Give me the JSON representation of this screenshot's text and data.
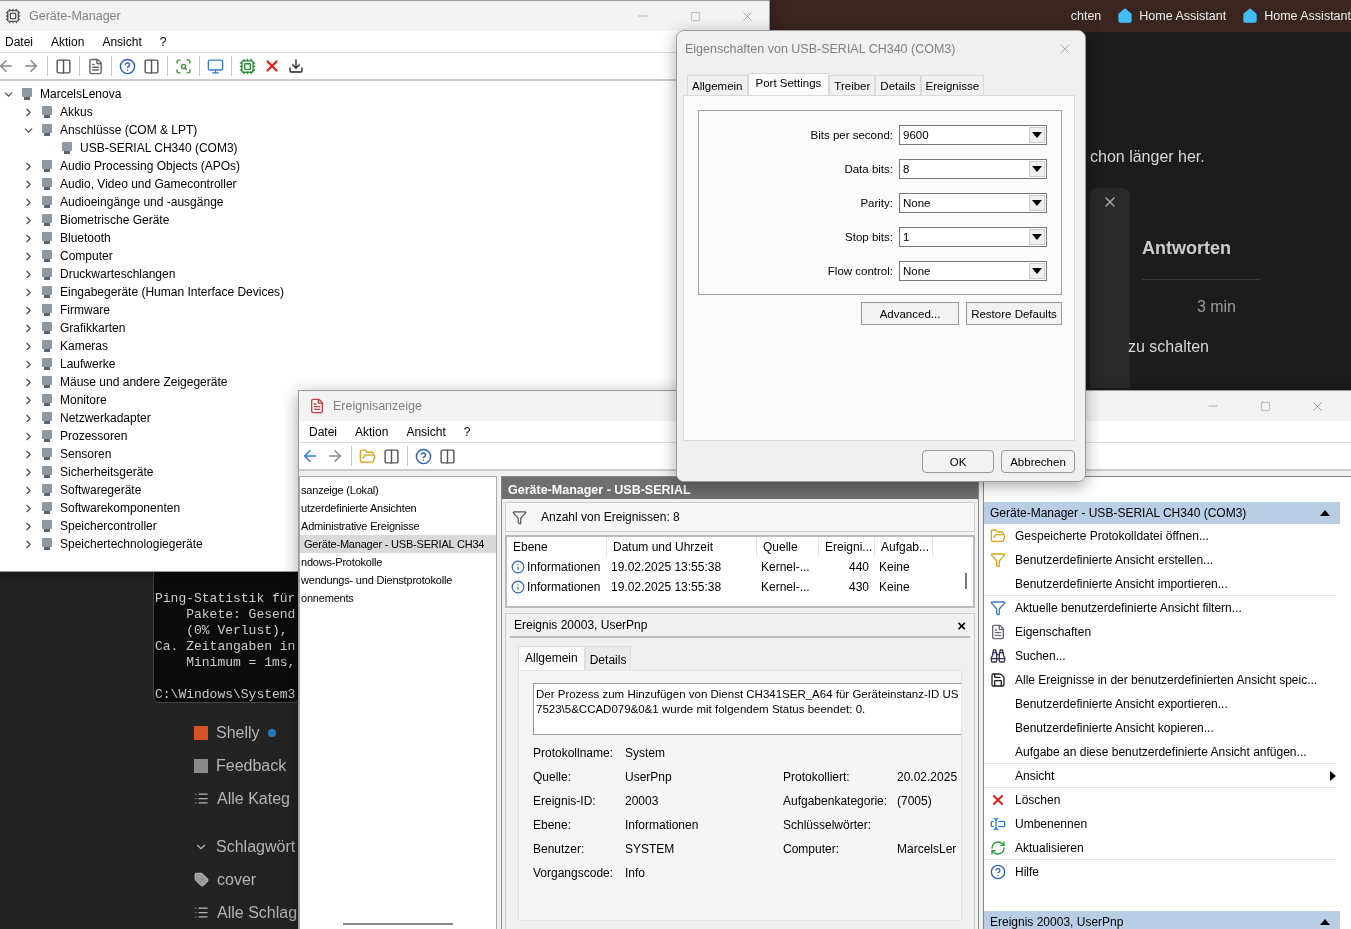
{
  "browser": {
    "tabs": [
      {
        "label": "chten",
        "icon": false
      },
      {
        "label": "Home Assistant",
        "icon": true
      },
      {
        "label": "Home Assistant",
        "icon": true
      }
    ],
    "heading": "chon länger her.",
    "reply_button": "Antworten",
    "time": "3 min",
    "text": "zu schalten",
    "sidebar": [
      {
        "kind": "category",
        "label": "Shelly",
        "color": "#d4512a",
        "unread": true
      },
      {
        "kind": "category",
        "label": "Feedback",
        "color": "#8a8a8a"
      },
      {
        "kind": "list",
        "label": "Alle Kateg"
      },
      {
        "kind": "section",
        "label": "Schlagwört",
        "expanded": true
      },
      {
        "kind": "tag",
        "label": "cover"
      },
      {
        "kind": "list",
        "label": "Alle Schlag"
      }
    ]
  },
  "terminal": {
    "lines": [
      "Ping-Statistik für",
      "    Pakete: Gesend",
      "    (0% Verlust),",
      "Ca. Zeitangaben in",
      "    Minimum = 1ms,"
    ],
    "prompt": "C:\\Windows\\System3"
  },
  "device_manager": {
    "title": "Geräte-Manager",
    "menu": [
      "Datei",
      "Aktion",
      "Ansicht",
      "?"
    ],
    "tree": [
      {
        "label": "MarcelsLenova",
        "expanded": true,
        "children": [
          {
            "label": "Akkus",
            "expanded": false
          },
          {
            "label": "Anschlüsse (COM & LPT)",
            "expanded": true,
            "children": [
              {
                "label": "USB-SERIAL CH340 (COM3)"
              }
            ]
          },
          {
            "label": "Audio Processing Objects (APOs)",
            "expanded": false
          },
          {
            "label": "Audio, Video und Gamecontroller",
            "expanded": false
          },
          {
            "label": "Audioeingänge und -ausgänge",
            "expanded": false
          },
          {
            "label": "Biometrische Geräte",
            "expanded": false
          },
          {
            "label": "Bluetooth",
            "expanded": false
          },
          {
            "label": "Computer",
            "expanded": false
          },
          {
            "label": "Druckwarteschlangen",
            "expanded": false
          },
          {
            "label": "Eingabegeräte (Human Interface Devices)",
            "expanded": false
          },
          {
            "label": "Firmware",
            "expanded": false
          },
          {
            "label": "Grafikkarten",
            "expanded": false
          },
          {
            "label": "Kameras",
            "expanded": false
          },
          {
            "label": "Laufwerke",
            "expanded": false
          },
          {
            "label": "Mäuse und andere Zeigegeräte",
            "expanded": false
          },
          {
            "label": "Monitore",
            "expanded": false
          },
          {
            "label": "Netzwerkadapter",
            "expanded": false
          },
          {
            "label": "Prozessoren",
            "expanded": false
          },
          {
            "label": "Sensoren",
            "expanded": false
          },
          {
            "label": "Sicherheitsgeräte",
            "expanded": false
          },
          {
            "label": "Softwaregeräte",
            "expanded": false
          },
          {
            "label": "Softwarekomponenten",
            "expanded": false
          },
          {
            "label": "Speichercontroller",
            "expanded": false
          },
          {
            "label": "Speichertechnologiegeräte",
            "expanded": false
          }
        ]
      }
    ]
  },
  "event_viewer": {
    "title": "Ereignisanzeige",
    "menu": [
      "Datei",
      "Aktion",
      "Ansicht",
      "?"
    ],
    "tree_items": [
      {
        "label": "sanzeige (Lokal)",
        "selected": false
      },
      {
        "label": "utzerdefinierte Ansichten",
        "selected": false
      },
      {
        "label": "Administrative Ereignisse",
        "selected": false
      },
      {
        "label": "Geräte-Manager - USB-SERIAL CH34",
        "selected": true
      },
      {
        "label": "ndows-Protokolle",
        "selected": false
      },
      {
        "label": "wendungs- und Dienstprotokolle",
        "selected": false
      },
      {
        "label": "onnements",
        "selected": false
      }
    ],
    "header": "Geräte-Manager - USB-SERIAL",
    "filter_text": "Anzahl von Ereignissen: 8",
    "columns": [
      "Ebene",
      "Datum und Uhrzeit",
      "Quelle",
      "Ereigni...",
      "Aufgab..."
    ],
    "rows": [
      [
        "Informationen",
        "19.02.2025 13:55:38",
        "Kernel-...",
        "440",
        "Keine"
      ],
      [
        "Informationen",
        "19.02.2025 13:55:38",
        "Kernel-...",
        "430",
        "Keine"
      ]
    ],
    "detail": {
      "title": "Ereignis 20003, UserPnp",
      "close": "×",
      "tabs": [
        {
          "label": "Allgemein",
          "selected": true
        },
        {
          "label": "Details",
          "selected": false
        }
      ],
      "description_lines": [
        "Der Prozess zum Hinzufügen von Dienst CH341SER_A64 für Geräteinstanz-ID US",
        "7523\\5&CCAD079&0&1 wurde mit folgendem Status beendet: 0."
      ],
      "fields": [
        {
          "label": "Protokollname:",
          "value": "System"
        },
        {
          "label": "Quelle:",
          "value": "UserPnp",
          "label2": "Protokolliert:",
          "value2": "20.02.2025"
        },
        {
          "label": "Ereignis-ID:",
          "value": "20003",
          "label2": "Aufgabenkategorie:",
          "value2": "(7005)"
        },
        {
          "label": "Ebene:",
          "value": "Informationen",
          "label2": "Schlüsselwörter:"
        },
        {
          "label": "Benutzer:",
          "value": "SYSTEM",
          "label2": "Computer:",
          "value2": "MarcelsLer"
        },
        {
          "label": "Vorgangscode:",
          "value": "Info"
        }
      ]
    },
    "actions": [
      {
        "title": "Geräte-Manager - USB-SERIAL CH340 (COM3)",
        "expanded": true,
        "items": [
          {
            "label": "Gespeicherte Protokolldatei öffnen...",
            "icon": true
          },
          {
            "label": "Benutzerdefinierte Ansicht erstellen...",
            "icon": true
          },
          {
            "label": "Benutzerdefinierte Ansicht importieren...",
            "icon": false,
            "separator": true
          },
          {
            "label": "Aktuelle benutzerdefinierte Ansicht filtern...",
            "icon": true
          },
          {
            "label": "Eigenschaften",
            "icon": true
          },
          {
            "label": "Suchen...",
            "icon": true
          },
          {
            "label": "Alle Ereignisse in der benutzerdefinierten Ansicht speic...",
            "icon": true
          },
          {
            "label": "Benutzerdefinierte Ansicht exportieren...",
            "icon": false
          },
          {
            "label": "Benutzerdefinierte Ansicht kopieren...",
            "icon": false
          },
          {
            "label": "Aufgabe an diese benutzerdefinierte Ansicht anfügen...",
            "icon": false,
            "separator": true
          },
          {
            "label": "Ansicht",
            "icon": false,
            "submenu": true,
            "separator": true
          },
          {
            "label": "Löschen",
            "icon": true
          },
          {
            "label": "Umbenennen",
            "icon": true
          },
          {
            "label": "Aktualisieren",
            "icon": true,
            "separator": true
          },
          {
            "label": "Hilfe",
            "icon": true
          }
        ]
      },
      {
        "title": "Ereignis 20003, UserPnp",
        "expanded": true
      }
    ]
  },
  "properties_dialog": {
    "title": "Eigenschaften von USB-SERIAL CH340 (COM3)",
    "tabs": [
      {
        "label": "Allgemein",
        "selected": false
      },
      {
        "label": "Port Settings",
        "selected": true
      },
      {
        "label": "Treiber",
        "selected": false
      },
      {
        "label": "Details",
        "selected": false
      },
      {
        "label": "Ereignisse",
        "selected": false
      }
    ],
    "fields": [
      {
        "label": "Bits per second:",
        "value": "9600"
      },
      {
        "label": "Data bits:",
        "value": "8"
      },
      {
        "label": "Parity:",
        "value": "None"
      },
      {
        "label": "Stop bits:",
        "value": "1"
      },
      {
        "label": "Flow control:",
        "value": "None"
      }
    ],
    "buttons": [
      "Advanced...",
      "Restore Defaults"
    ],
    "footer_buttons": [
      "OK",
      "Abbrechen"
    ]
  }
}
